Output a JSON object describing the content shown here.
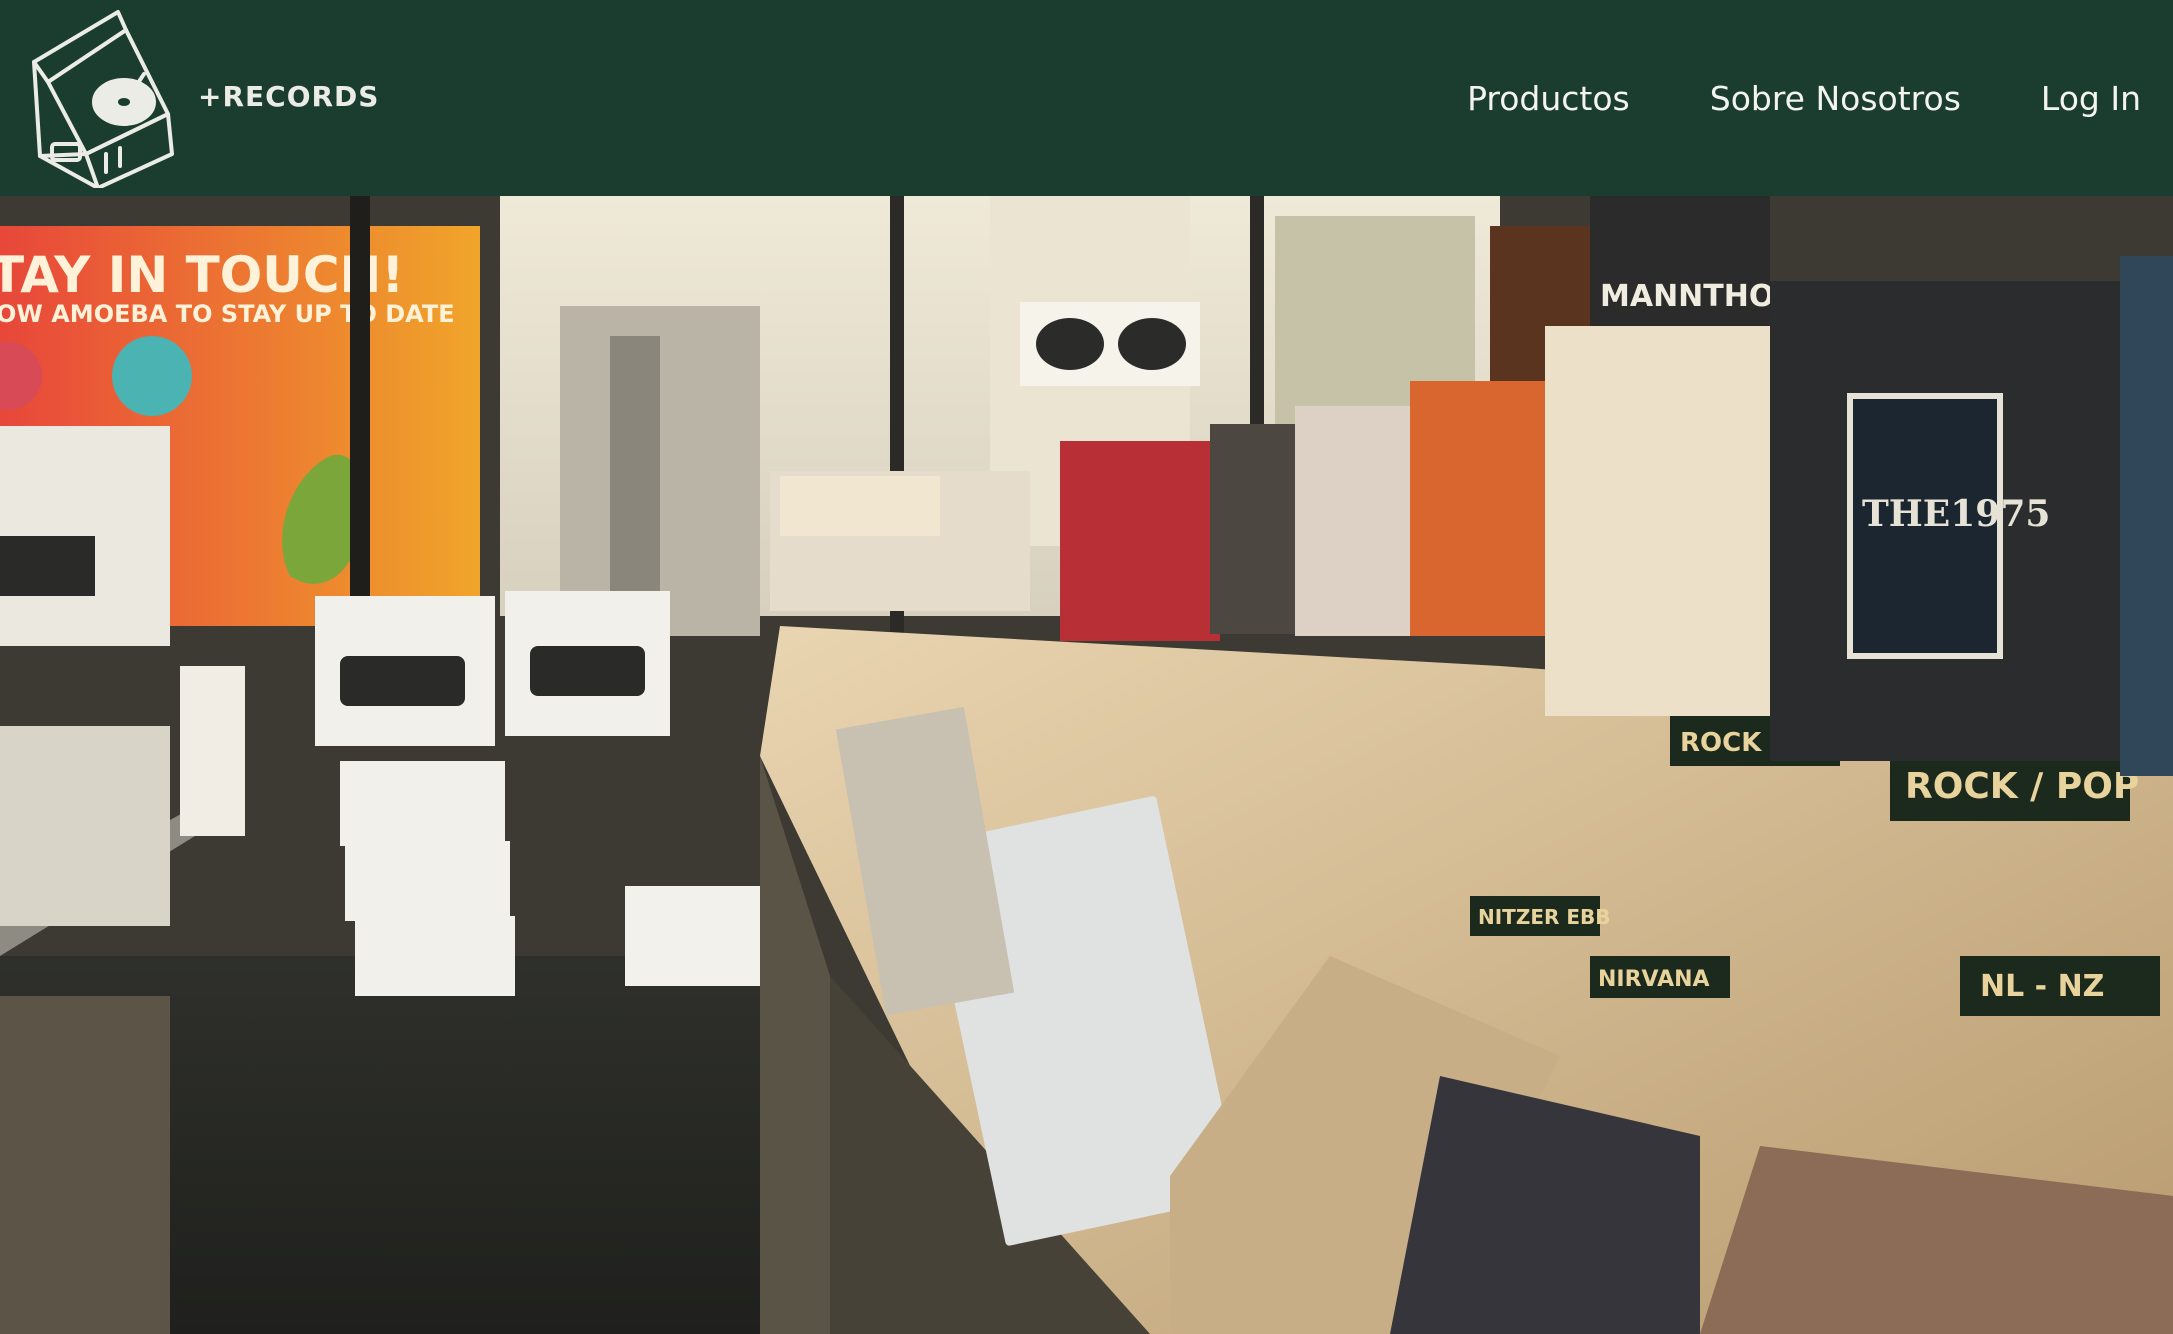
{
  "brand": {
    "name": "+RECORDS",
    "logo_icon": "record-player-icon"
  },
  "nav": {
    "items": [
      {
        "label": "Productos"
      },
      {
        "label": "Sobre Nosotros"
      },
      {
        "label": "Log In"
      }
    ]
  },
  "hero": {
    "image": "record-store-photo",
    "poster_title": "TAY IN TOUCH!",
    "poster_subtitle": "OW AMOEBA TO STAY UP TO DATE",
    "record_titles": [
      "MANNTHOLOGY",
      "THE1975"
    ],
    "bin_labels": [
      "ROCK / POP",
      "ROCK / POP",
      "NIRVANA",
      "NITZER EBB",
      "NL - NZ"
    ]
  },
  "colors": {
    "nav_bg": "#1b3d2f",
    "nav_text": "#f4f4ee"
  }
}
